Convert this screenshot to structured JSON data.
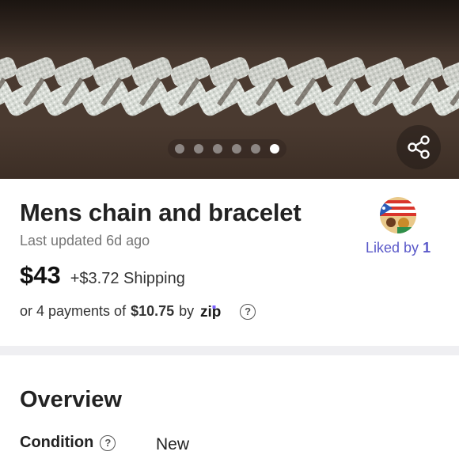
{
  "listing": {
    "title": "Mens chain and bracelet",
    "updated": "Last updated 6d ago",
    "price": "$43",
    "shipping": "+$3.72 Shipping"
  },
  "installments": {
    "prefix": "or 4 payments of",
    "amount": "$10.75",
    "by": "by",
    "provider_logo_text": "zip",
    "provider_color": "#5a3fd0"
  },
  "likes": {
    "label": "Liked by",
    "count": "1",
    "accent_color": "#5a59c9"
  },
  "gallery": {
    "total_images": 6,
    "active_index": 5,
    "share_icon": "share-icon"
  },
  "overview": {
    "heading": "Overview",
    "condition_label": "Condition",
    "condition_value": "New"
  },
  "icons": {
    "help": "?"
  }
}
